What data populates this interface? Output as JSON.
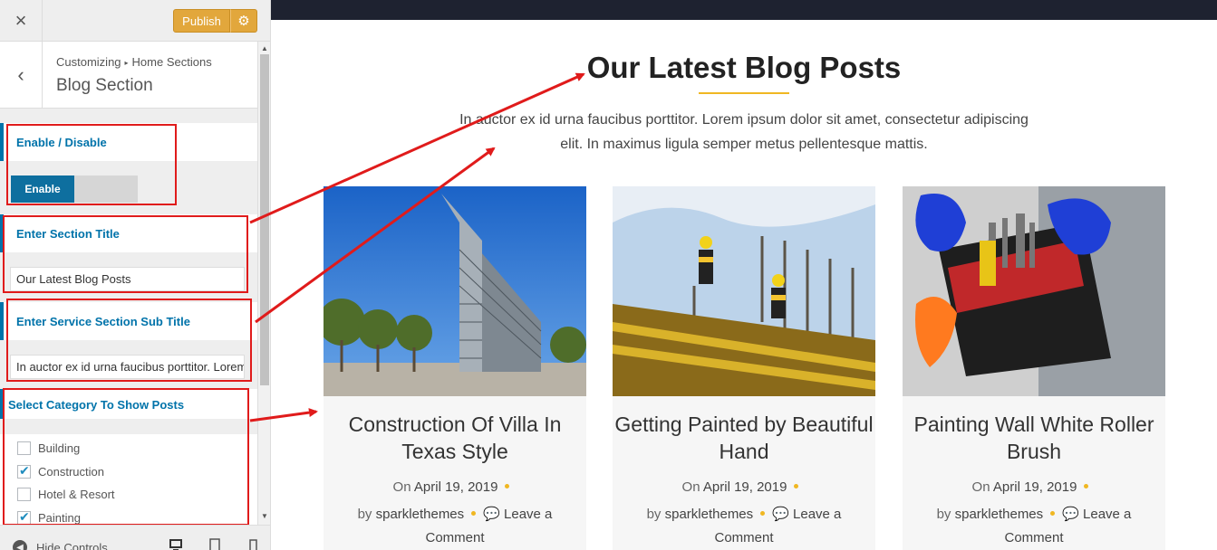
{
  "topbar": {
    "close_icon": "×",
    "publish_label": "Publish",
    "gear_icon": "⚙"
  },
  "section_header": {
    "back_icon": "‹",
    "breadcrumb_root": "Customizing",
    "breadcrumb_separator": "▸",
    "breadcrumb_current": "Home Sections",
    "title": "Blog Section"
  },
  "controls": {
    "enable": {
      "label": "Enable / Disable",
      "toggle_on": "Enable"
    },
    "section_title": {
      "label": "Enter Section Title",
      "value": "Our Latest Blog Posts"
    },
    "sub_title": {
      "label": "Enter Service Section Sub Title",
      "value": "In auctor ex id urna faucibus porttitor. Lorem ipsum dolor sit amet"
    },
    "category": {
      "label": "Select Category To Show Posts",
      "items": [
        {
          "label": "Building",
          "checked": false
        },
        {
          "label": "Construction",
          "checked": true
        },
        {
          "label": "Hotel & Resort",
          "checked": false
        },
        {
          "label": "Painting",
          "checked": true
        }
      ]
    }
  },
  "footer": {
    "hide_controls": "Hide Controls"
  },
  "preview": {
    "heading": "Our Latest Blog Posts",
    "subtitle": "In auctor ex id urna faucibus porttitor. Lorem ipsum dolor sit amet, consectetur adipiscing elit. In maximus ligula semper metus pellentesque mattis.",
    "posts": [
      {
        "title": "Construction Of Villa In Texas Style",
        "date_prefix": "On",
        "date": "April 19, 2019",
        "by": "by",
        "author": "sparklethemes",
        "comment": "Leave a Comment"
      },
      {
        "title": "Getting Painted by Beautiful Hand",
        "date_prefix": "On",
        "date": "April 19, 2019",
        "by": "by",
        "author": "sparklethemes",
        "comment": "Leave a Comment"
      },
      {
        "title": "Painting Wall White Roller Brush",
        "date_prefix": "On",
        "date": "April 19, 2019",
        "by": "by",
        "author": "sparklethemes",
        "comment": "Leave a Comment"
      }
    ]
  },
  "colors": {
    "accent": "#0073aa",
    "publish": "#e2a73c",
    "highlight": "#e01b1b",
    "heading_line": "#f0b722"
  }
}
